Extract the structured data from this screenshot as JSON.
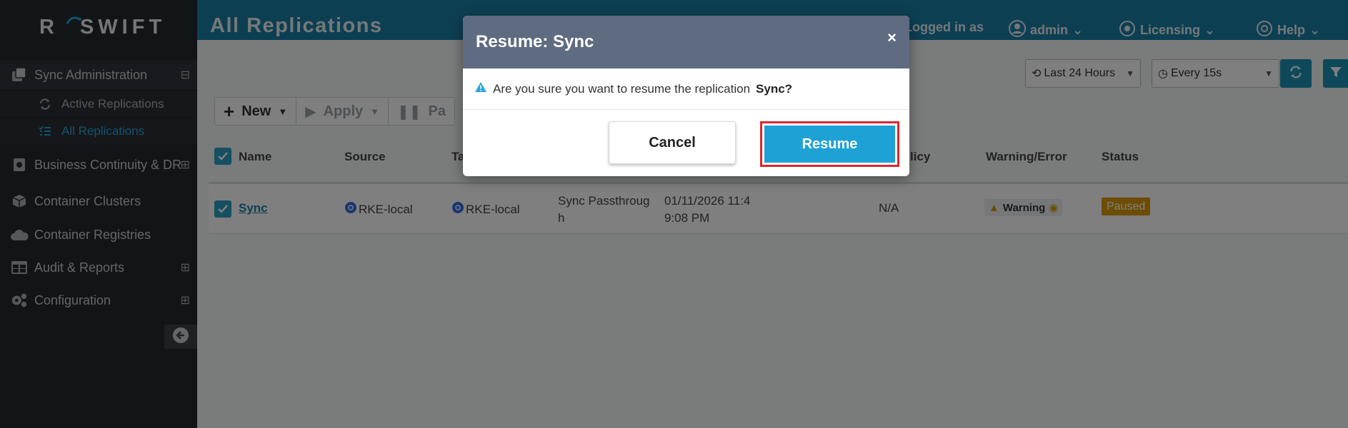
{
  "app": {
    "logo_letter": "R",
    "logo_text": "SWIFT"
  },
  "sidebar": {
    "sync_admin": {
      "label": "Sync Administration",
      "icon": "copy-icon",
      "toggle": "⊟"
    },
    "sub_items": [
      {
        "label": "Active Replications",
        "icon": "refresh-icon"
      },
      {
        "label": "All Replications",
        "icon": "list-check-icon"
      }
    ],
    "items": [
      {
        "label": "Business Continuity & DR",
        "icon": "server-icon",
        "toggle": "⊞"
      },
      {
        "label": "Container Clusters",
        "icon": "cube-icon"
      },
      {
        "label": "Container Registries",
        "icon": "cloud-icon"
      },
      {
        "label": "Audit & Reports",
        "icon": "table-icon",
        "toggle": "⊞"
      },
      {
        "label": "Configuration",
        "icon": "gears-icon",
        "toggle": "⊞"
      }
    ]
  },
  "header": {
    "title": "All Replications",
    "logged_in_as": "Logged in as",
    "user": "admin",
    "licensing": "Licensing",
    "help": "Help"
  },
  "filters": {
    "time_range": "Last 24 Hours",
    "refresh_interval": "Every 15s"
  },
  "toolbar": {
    "new_label": "New",
    "apply_label": "Apply",
    "pause_label": "Pa"
  },
  "table": {
    "headers": {
      "name": "Name",
      "source": "Source",
      "target": "Ta",
      "policy": "licy",
      "warning": "Warning/Error",
      "status": "Status"
    },
    "rows": [
      {
        "name": "Sync",
        "source": "RKE-local",
        "target": "RKE-local",
        "type_line1": "Sync Passthroug",
        "type_line2": "h",
        "time_line1": "01/11/2026 11:4",
        "time_line2": "9:08 PM",
        "policy": "N/A",
        "warning": "Warning",
        "status": "Paused"
      }
    ]
  },
  "modal": {
    "title": "Resume: Sync",
    "close": "×",
    "message": "Are you sure you want to resume the replication",
    "target": "Sync?",
    "cancel_label": "Cancel",
    "resume_label": "Resume"
  },
  "colors": {
    "sidebar_bg": "#252a31",
    "topbar": "#1a7fa6",
    "accent": "#1ea2d6",
    "modal_header": "#5e6b80",
    "highlight": "#e0262e",
    "status_paused": "#d99a07"
  }
}
